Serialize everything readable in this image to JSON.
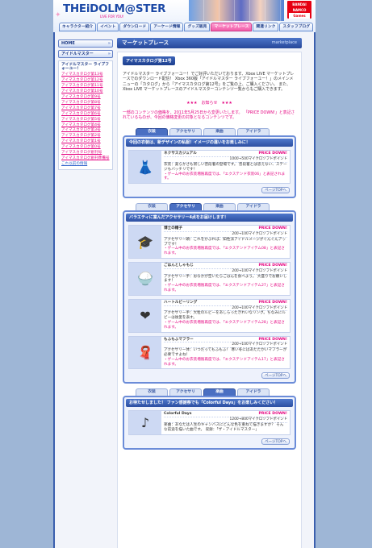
{
  "header": {
    "logo": "THEiDOLM@STER",
    "logo_sub": "LIVE FOR YOU!",
    "bandai": [
      "BANDAI",
      "NAMCO",
      "Games"
    ],
    "nav": [
      {
        "label": "キャラクター紹介",
        "active": false
      },
      {
        "label": "イベント",
        "active": false
      },
      {
        "label": "ダウンロード",
        "active": false
      },
      {
        "label": "アーケード情報",
        "active": false
      },
      {
        "label": "グッズ販売",
        "active": false
      },
      {
        "label": "マーケットプレース",
        "active": true
      },
      {
        "label": "関連リンク",
        "active": false
      },
      {
        "label": "スタッフブログ",
        "active": false
      }
    ]
  },
  "sidebar": {
    "home": "HOME",
    "section": "アイドルマスター",
    "list_title": "アイドルマスター ライブフォーユー！",
    "links": [
      "アイマスカタログ第13号",
      "アイマスカタログ第12号",
      "アイマスカタログ第11号",
      "アイマスカタログ第10号",
      "アイマスカタログ第9号",
      "アイマスカタログ第8号",
      "アイマスカタログ第7号",
      "アイマスカタログ第6号",
      "アイマスカタログ第5号",
      "アイマスカタログ第4号",
      "アイマスカタログ第3号",
      "アイマスカタログ第2号",
      "アイマスカタログ第1号",
      "アイマスカタログ第0号",
      "アイマスカタログ創刊号",
      "アイマスカタログ創刊準備号",
      "過去掲載分",
      "アイマスカタログ第5号",
      "アイマスカタログ第4号",
      "アイマスカタログ第3号",
      "アイマスカタログ第2号",
      "アイマスカタログ第1号",
      "アイマスカタログ創刊号"
    ],
    "last_link": "これ以前の情報"
  },
  "main": {
    "title": "マーケットプレース",
    "title_en": "marketplace",
    "catalog_badge": "アイマスカタログ第12号",
    "intro": "アイドルマスター ライブフォーユー！でご好評いただいております、Xbox LIVE マーケットプレースでのダウンロード配信！ Xbox 360版「アイドルマスター ライブフォーユー！」のメインメニューの「カタログ」から「アイマスカタログ第12号」をご覧の上、ご購入ください。 また、Xbox LIVE マーケットプレースのアイドルマスターコンテンツ一覧からもご購入できます。",
    "news": "★★★　お知らせ　★★★",
    "notice": "一部のコンテンツの価格を、2011年5月25日から変更いたします。 「PRICE DOWN!」と表記されているものが、今回の価格変更の対象となるコンテンツです。",
    "tabs": [
      "衣装",
      "アクセサリ",
      "楽曲",
      "アイドラ"
    ],
    "page_top": "ページTOPへ",
    "costume_box": {
      "active_tab": 0,
      "title": "今回の衣装は、新デザインの私服！イメージの違いをお楽しみに！",
      "items": [
        {
          "name": "ネクサスカジュアル",
          "price_down": "PRICE DOWN!",
          "price": "1000→500マイクロソフトポイント",
          "desc": "衣装：柔らかさも新しい普段着の登場です。 普段着とは思えない、ステージもバッチリです！",
          "note": "・ゲーム中のお衣装増殖再度では、「エクステンド衣装06」と表記されます。"
        }
      ]
    },
    "accessory_box": {
      "active_tab": 1,
      "title": "バラエティに富んだアクセサリー4点をお届けします！",
      "items": [
        {
          "name": "博士の帽子",
          "price_down": "PRICE DOWN!",
          "price": "200→100マイクロソフトポイント",
          "desc": "アクセサリー頭：これをかぶれば、知性派アイドルメージがぐんぐんアップです！",
          "note": "・ゲーム中のお衣装増殖再度では、「エクステンドアイテム08」と表記されます。"
        },
        {
          "name": "ごはんとしゃもじ",
          "price_down": "PRICE DOWN!",
          "price": "200→100マイクロソフトポイント",
          "desc": "アクセサリー手：おなかが空いたらごはんを食べよう。 大盛りでお願いします！",
          "note": "・ゲーム中のお衣装増殖再度では、「エクステンドアイテム27」と表記されます。"
        },
        {
          "name": "ハートルビーリング",
          "price_down": "PRICE DOWN!",
          "price": "200→100マイクロソフトポイント",
          "desc": "アクセサリー手：大粒のルビーをあしらったきれいなリング。ちなみにルビーは後愛を表す。",
          "note": "・ゲーム中のお衣装増殖再度では、「エクステンドアイテム28」と表記されます。"
        },
        {
          "name": "もふもふマフラー",
          "price_down": "PRICE DOWN!",
          "price": "200→100マイクロソフトポイント",
          "desc": "アクセサリー体：いつだってもふもふ！ 寒い冬にはあたたかいマフラーが必要ですよね！",
          "note": "・ゲーム中のお衣装増殖再度では、「エクステンドアイテム17」と表記されます。"
        }
      ]
    },
    "song_box": {
      "active_tab": 2,
      "title": "お待たせしました！ ファン感謝祭でも「Colorful Days」をお楽しみください！",
      "items": [
        {
          "name": "Colorful Days",
          "price_down": "PRICE DOWN!",
          "price": "1200→800マイクロソフトポイント",
          "desc": "楽曲：あなたは人生のキャンバスにどんな色を重ねて描きますか？ そんな前途を描いた曲です。 収録：「ザ・アイドルマスター」",
          "note": ""
        }
      ]
    }
  }
}
